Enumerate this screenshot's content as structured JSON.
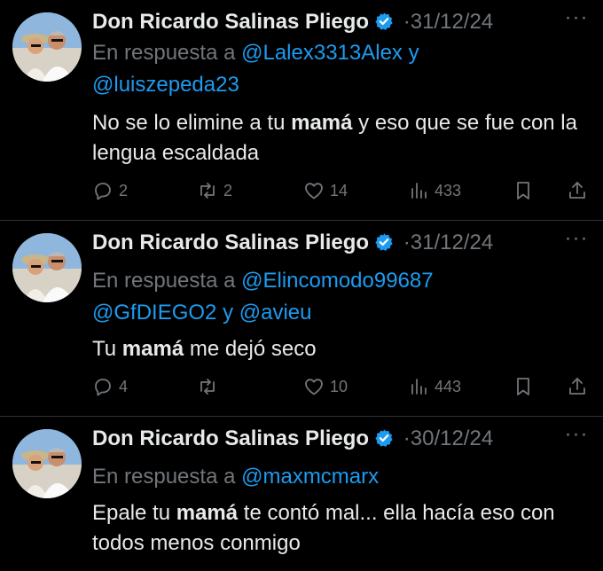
{
  "tweets": [
    {
      "author": "Don Ricardo Salinas Pliego",
      "date": "31/12/24",
      "separator": "·",
      "reply_prefix": "En respuesta a",
      "mentions": [
        "@Lalex3313Alex",
        "@luiszepeda23"
      ],
      "joiner": "y",
      "text_parts": [
        "No se lo elimine a tu ",
        "mamá",
        " y eso que se fue con la lengua escaldada"
      ],
      "stats": {
        "replies": "2",
        "retweets": "2",
        "likes": "14",
        "views": "433"
      }
    },
    {
      "author": "Don Ricardo Salinas Pliego",
      "date": "31/12/24",
      "separator": "·",
      "reply_prefix": "En respuesta a",
      "mentions": [
        "@Elincomodo99687",
        "@GfDIEGO2",
        "@avieu"
      ],
      "joiner": "y",
      "text_parts": [
        "Tu ",
        "mamá",
        " me dejó seco"
      ],
      "stats": {
        "replies": "4",
        "retweets": "",
        "likes": "10",
        "views": "443"
      }
    },
    {
      "author": "Don Ricardo Salinas Pliego",
      "date": "30/12/24",
      "separator": "·",
      "reply_prefix": "En respuesta a",
      "mentions": [
        "@maxmcmarx"
      ],
      "joiner": "",
      "text_parts": [
        "Epale tu ",
        "mamá",
        " te contó mal... ella hacía eso con todos menos conmigo"
      ],
      "stats": {
        "replies": "",
        "retweets": "",
        "likes": "",
        "views": ""
      }
    }
  ],
  "colors": {
    "background": "#000000",
    "text": "#e7e9ea",
    "muted": "#71767b",
    "link": "#1d9bf0",
    "verified": "#1d9bf0",
    "divider": "#2f3336"
  },
  "icons": {
    "reply": "reply-icon",
    "retweet": "retweet-icon",
    "like": "heart-icon",
    "views": "views-icon",
    "bookmark": "bookmark-icon",
    "share": "share-icon",
    "more": "more-icon",
    "verified": "verified-badge-icon"
  }
}
